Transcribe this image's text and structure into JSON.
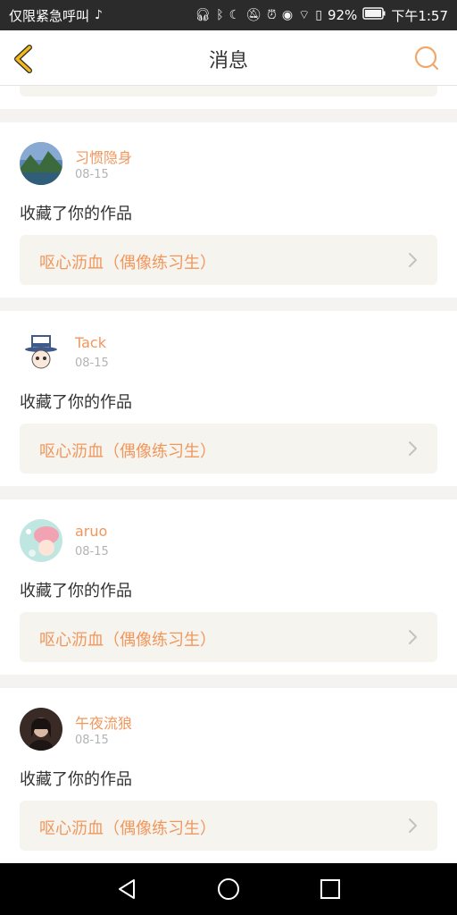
{
  "status_bar": {
    "left_text": "仅限紧急呼叫",
    "battery": "92%",
    "time": "下午1:57",
    "icons": [
      "tiktok-icon",
      "headphones-icon",
      "bluetooth-icon",
      "moon-icon",
      "mute-icon",
      "alarm-icon",
      "eye-icon",
      "wifi-icon",
      "battery-alert-icon",
      "battery-icon"
    ]
  },
  "header": {
    "title": "消息",
    "back_icon": "chevron-left-icon",
    "search_icon": "search-icon"
  },
  "colors": {
    "accent": "#f0975c",
    "back_arrow": "#f2b81c",
    "page_bg": "#f5f3f1",
    "card_bg": "#ffffff",
    "work_bg": "#f6f4ef"
  },
  "messages": [
    {
      "username": "习惯隐身",
      "date": "08-15",
      "action": "收藏了你的作品",
      "work_title": "呕心沥血（偶像练习生）",
      "avatar": "landscape-avatar"
    },
    {
      "username": "Tack",
      "date": "08-15",
      "action": "收藏了你的作品",
      "work_title": "呕心沥血（偶像练习生）",
      "avatar": "cartoon-hat-avatar"
    },
    {
      "username": "aruo",
      "date": "08-15",
      "action": "收藏了你的作品",
      "work_title": "呕心沥血（偶像练习生）",
      "avatar": "pink-hat-avatar"
    },
    {
      "username": "午夜流狼",
      "date": "08-15",
      "action": "收藏了你的作品",
      "work_title": "呕心沥血（偶像练习生）",
      "avatar": "portrait-avatar"
    }
  ],
  "nav_bar": {
    "icons": [
      "back-triangle-icon",
      "home-circle-icon",
      "recents-square-icon"
    ]
  }
}
